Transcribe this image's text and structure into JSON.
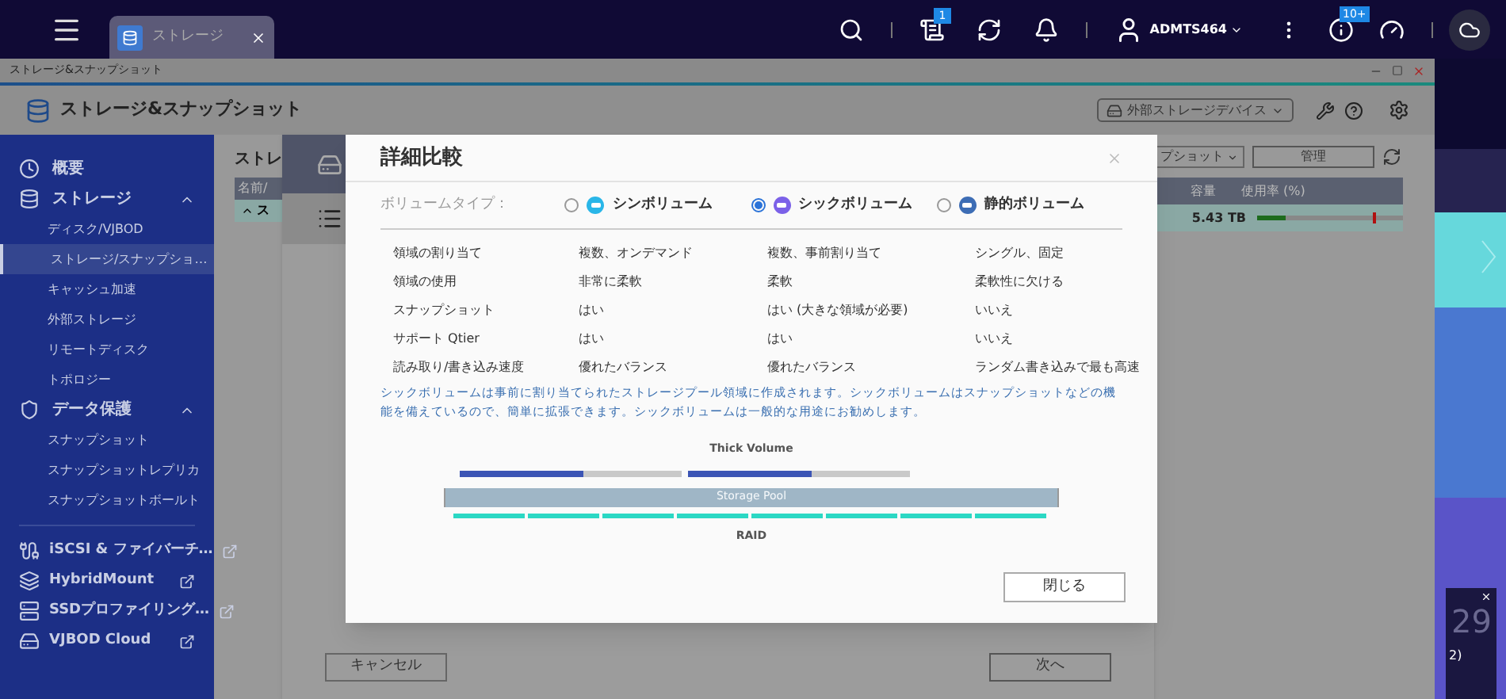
{
  "topbar": {
    "tab": {
      "label": "ストレージ",
      "selected": true
    },
    "notification_badge": "1",
    "user": "ADMTS464",
    "info_badge": "10+"
  },
  "window": {
    "title": "ストレージ&スナップショット",
    "app_title": "ストレージ&スナップショット",
    "device_dropdown": "外部ストレージデバイス"
  },
  "sidebar": [
    {
      "kind": "group",
      "label": "概要"
    },
    {
      "kind": "group",
      "label": "ストレージ",
      "expanded": true,
      "children": [
        {
          "label": "ディスク/VJBOD",
          "selected": false
        },
        {
          "label": "ストレージ/スナップショ…",
          "selected": true
        },
        {
          "label": "キャッシュ加速",
          "selected": false
        },
        {
          "label": "外部ストレージ",
          "selected": false
        },
        {
          "label": "リモートディスク",
          "selected": false
        },
        {
          "label": "トポロジー",
          "selected": false
        }
      ]
    },
    {
      "kind": "group",
      "label": "データ保護",
      "expanded": true,
      "children": [
        {
          "label": "スナップショット",
          "selected": false
        },
        {
          "label": "スナップショットレプリカ",
          "selected": false
        },
        {
          "label": "スナップショットボールト",
          "selected": false
        }
      ]
    },
    {
      "kind": "link",
      "label": "iSCSI & ファイバーチ…"
    },
    {
      "kind": "link",
      "label": "HybridMount"
    },
    {
      "kind": "link",
      "label": "SSDプロファイリング…"
    },
    {
      "kind": "link",
      "label": "VJBOD Cloud"
    }
  ],
  "main": {
    "title_fragment": "ストレ",
    "column_fragment": "名前/",
    "row_fragment": "ス",
    "snapshot_dropdown": "プショット",
    "manage_button": "管理",
    "columns": [
      "容量",
      "使用率 (%)"
    ],
    "row": {
      "capacity": "5.43 TB",
      "level": 0.2
    }
  },
  "wizard": {
    "cancel": "キャンセル",
    "next": "次へ"
  },
  "modal": {
    "title": "詳細比較",
    "type_label": "ボリュームタイプ：",
    "options": [
      {
        "label": "シンボリューム",
        "selected": false,
        "color": "#29b6e8"
      },
      {
        "label": "シックボリューム",
        "selected": true,
        "color": "#7b61e8"
      },
      {
        "label": "静的ボリューム",
        "selected": false,
        "color": "#3d6db5"
      }
    ],
    "rows": [
      [
        "領域の割り当て",
        "複数、オンデマンド",
        "複数、事前割り当て",
        "シングル、固定"
      ],
      [
        "領域の使用",
        "非常に柔軟",
        "柔軟",
        "柔軟性に欠ける"
      ],
      [
        "スナップショット",
        "はい",
        "はい (大きな領域が必要)",
        "いいえ"
      ],
      [
        "サポート Qtier",
        "はい",
        "はい",
        "いいえ"
      ],
      [
        "読み取り/書き込み速度",
        "優れたバランス",
        "優れたバランス",
        "ランダム書き込みで最も高速"
      ]
    ],
    "description": "シックボリュームは事前に割り当てられたストレージプール領域に作成されます。シックボリュームはスナップショットなどの機能を備えているので、簡単に拡張できます。シックボリュームは一般的な用途にお勧めします。",
    "diagram": {
      "volume_label": "Thick Volume",
      "volumes": [
        {
          "level": 0.56
        },
        {
          "level": 0.56
        }
      ],
      "pool_label": "Storage Pool",
      "raid_label": "RAID"
    },
    "close_button": "閉じる"
  },
  "widget": {
    "value": "29",
    "note": "2)"
  }
}
